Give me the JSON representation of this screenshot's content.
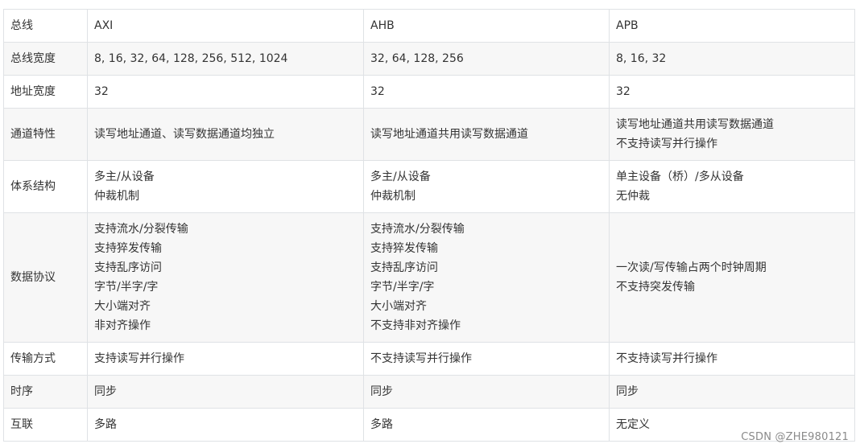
{
  "table": {
    "header": [
      "总线",
      "AXI",
      "AHB",
      "APB"
    ],
    "rows": [
      {
        "label": "总线宽度",
        "axi": [
          "8, 16, 32, 64, 128, 256, 512, 1024"
        ],
        "ahb": [
          "32, 64, 128, 256"
        ],
        "apb": [
          "8, 16, 32"
        ]
      },
      {
        "label": "地址宽度",
        "axi": [
          "32"
        ],
        "ahb": [
          "32"
        ],
        "apb": [
          "32"
        ]
      },
      {
        "label": "通道特性",
        "axi": [
          "读写地址通道、读写数据通道均独立"
        ],
        "ahb": [
          "读写地址通道共用读写数据通道"
        ],
        "apb": [
          "读写地址通道共用读写数据通道",
          "不支持读写并行操作"
        ]
      },
      {
        "label": "体系结构",
        "axi": [
          "多主/从设备",
          "仲裁机制"
        ],
        "ahb": [
          "多主/从设备",
          "仲裁机制"
        ],
        "apb": [
          "单主设备（桥）/多从设备",
          "无仲裁"
        ]
      },
      {
        "label": "数据协议",
        "axi": [
          "支持流水/分裂传输",
          "支持猝发传输",
          "支持乱序访问",
          "字节/半字/字",
          "大小端对齐",
          "非对齐操作"
        ],
        "ahb": [
          "支持流水/分裂传输",
          "支持猝发传输",
          "支持乱序访问",
          "字节/半字/字",
          "大小端对齐",
          "不支持非对齐操作"
        ],
        "apb": [
          "一次读/写传输占两个时钟周期",
          "不支持突发传输"
        ]
      },
      {
        "label": "传输方式",
        "axi": [
          "支持读写并行操作"
        ],
        "ahb": [
          "不支持读写并行操作"
        ],
        "apb": [
          "不支持读写并行操作"
        ]
      },
      {
        "label": "时序",
        "axi": [
          "同步"
        ],
        "ahb": [
          "同步"
        ],
        "apb": [
          "同步"
        ]
      },
      {
        "label": "互联",
        "axi": [
          "多路"
        ],
        "ahb": [
          "多路"
        ],
        "apb": [
          "无定义"
        ]
      }
    ]
  },
  "watermark": "CSDN @ZHE980121"
}
